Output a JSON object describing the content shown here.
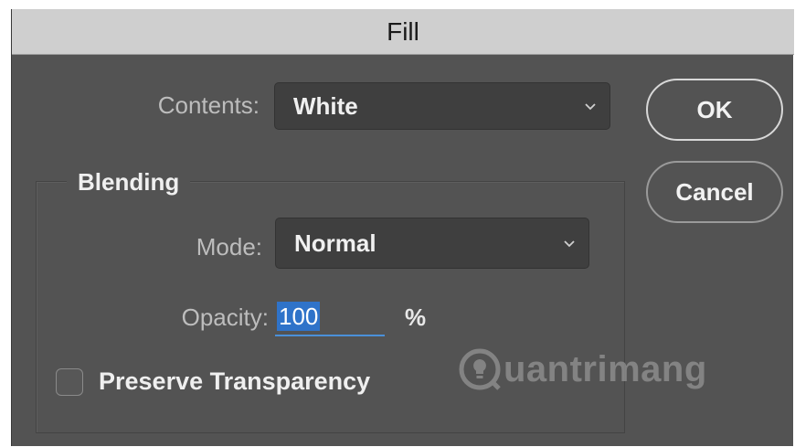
{
  "window": {
    "title": "Fill"
  },
  "contents": {
    "label": "Contents:",
    "value": "White"
  },
  "buttons": {
    "ok": "OK",
    "cancel": "Cancel"
  },
  "blending": {
    "group_label": "Blending",
    "mode_label": "Mode:",
    "mode_value": "Normal",
    "opacity_label": "Opacity:",
    "opacity_value": "100",
    "opacity_unit": "%",
    "preserve_label": "Preserve Transparency",
    "preserve_checked": false
  },
  "watermark": {
    "text": "uantrimang"
  },
  "icons": {
    "dropdown": "chevron-down-icon",
    "watermark": "lightbulb-icon"
  }
}
